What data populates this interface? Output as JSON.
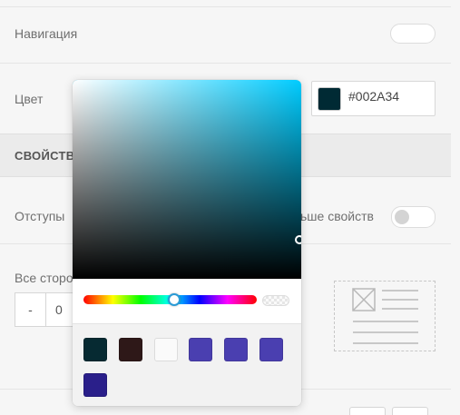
{
  "settings": {
    "navigation_label": "Навигация",
    "color_label": "Цвет",
    "color_value": "#002A34",
    "section_title": "СВОЙСТВ",
    "padding_label": "Отступы",
    "more_props_label": "ьше свойств",
    "all_sides_label": "Все сторо",
    "stepper_minus": "-",
    "stepper_value": "0"
  },
  "picker": {
    "hue_color": "#00ccff",
    "current_color": "#002A34",
    "presets": [
      {
        "name": "preset-dark-teal",
        "color": "#062a32"
      },
      {
        "name": "preset-dark-brown",
        "color": "#2e1818"
      },
      {
        "name": "preset-white",
        "color": "#fafafa"
      },
      {
        "name": "preset-indigo-1",
        "color": "#4a3fb0"
      },
      {
        "name": "preset-indigo-2",
        "color": "#4a3fb0"
      },
      {
        "name": "preset-indigo-3",
        "color": "#4a3fb0"
      },
      {
        "name": "preset-navy",
        "color": "#2a1f8a"
      }
    ]
  }
}
